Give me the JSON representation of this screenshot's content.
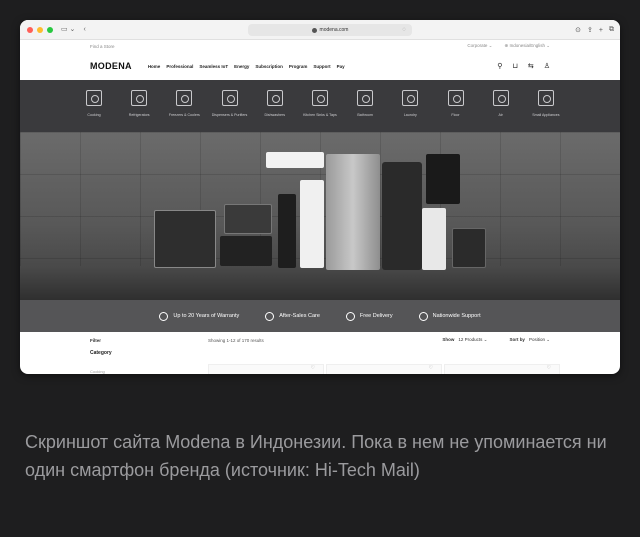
{
  "browser": {
    "url": "modena.com"
  },
  "utility": {
    "find_store": "Find a Store",
    "corporate": "Corporate",
    "language": "Indonesia/English"
  },
  "nav": {
    "logo": "MODENA",
    "links": [
      "Home",
      "Professional",
      "Seamless IoT",
      "Energy",
      "Subscription",
      "Program",
      "Support",
      "Pay"
    ]
  },
  "categories": [
    "Cooking",
    "Refrigerators",
    "Freezers & Coolers",
    "Dispensers & Purifiers",
    "Dishwashers",
    "Kitchen Sinks & Taps",
    "Bathroom",
    "Laundry",
    "Floor",
    "Air",
    "Small Appliances"
  ],
  "benefits": [
    "Up to 20 Years of Warranty",
    "After-Sales Care",
    "Free Delivery",
    "Nationwide Support"
  ],
  "listing": {
    "filter": "Filter",
    "showing": "Showing 1-12 of 170 results",
    "show_label": "Show",
    "show_value": "12 Products",
    "sort_label": "Sort by",
    "sort_value": "Position",
    "category_heading": "Category",
    "first_category": "Cooking"
  },
  "caption": "Скриншот сайта Modena в Индонезии. Пока в нем не упоминается ни один смартфон бренда (источник: Hi-Tech Mail)"
}
